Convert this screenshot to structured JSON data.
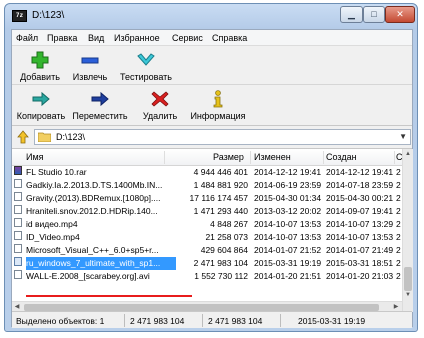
{
  "window": {
    "title": "D:\\123\\",
    "app_icon_text": "7z"
  },
  "menu": [
    "Файл",
    "Правка",
    "Вид",
    "Избранное",
    "Сервис",
    "Справка"
  ],
  "toolbar1": [
    {
      "label": "Добавить",
      "icon": "plus-icon"
    },
    {
      "label": "Извлечь",
      "icon": "minus-icon"
    },
    {
      "label": "Тестировать",
      "icon": "check-icon"
    }
  ],
  "toolbar2": [
    {
      "label": "Копировать",
      "icon": "copy-arrow-icon"
    },
    {
      "label": "Переместить",
      "icon": "move-arrow-icon"
    },
    {
      "label": "Удалить",
      "icon": "delete-x-icon"
    },
    {
      "label": "Информация",
      "icon": "info-icon"
    }
  ],
  "address": {
    "path": "D:\\123\\"
  },
  "columns": {
    "name": "Имя",
    "size": "Размер",
    "modified": "Изменен",
    "created": "Создан",
    "extra": "C"
  },
  "files": [
    {
      "name": "FL Studio 10.rar",
      "size": "4 944 446 401",
      "modified": "2014-12-12 19:41",
      "created": "2014-12-12 19:41",
      "extra": "2",
      "icon": "rar"
    },
    {
      "name": "Gadkiy.Ia.2.2013.D.TS.1400Mb.IN...",
      "size": "1 484 881 920",
      "modified": "2014-06-19 23:59",
      "created": "2014-07-18 23:59",
      "extra": "2",
      "icon": "doc"
    },
    {
      "name": "Gravity.(2013).BDRemux.[1080p]....",
      "size": "17 116 174 457",
      "modified": "2015-04-30 01:34",
      "created": "2015-04-30 00:21",
      "extra": "2",
      "icon": "doc"
    },
    {
      "name": "Hraniteli.snov.2012.D.HDRip.140...",
      "size": "1 471 293 440",
      "modified": "2013-03-12 20:02",
      "created": "2014-09-07 19:41",
      "extra": "2",
      "icon": "doc"
    },
    {
      "name": "id видео.mp4",
      "size": "4 848 267",
      "modified": "2014-10-07 13:53",
      "created": "2014-10-07 13:29",
      "extra": "2",
      "icon": "doc"
    },
    {
      "name": "ID_Video.mp4",
      "size": "21 258 073",
      "modified": "2014-10-07 13:53",
      "created": "2014-10-07 13:53",
      "extra": "2",
      "icon": "doc"
    },
    {
      "name": "Microsoft_Visual_C++_6.0+sp5+r...",
      "size": "429 604 864",
      "modified": "2014-01-07 21:52",
      "created": "2014-01-07 21:49",
      "extra": "2",
      "icon": "doc"
    },
    {
      "name": "ru_windows_7_ultimate_with_sp1...",
      "size": "2 471 983 104",
      "modified": "2015-03-31 19:19",
      "created": "2015-03-31 18:51",
      "extra": "2",
      "icon": "blue",
      "selected": true
    },
    {
      "name": "WALL-E.2008_[scarabey.org].avi",
      "size": "1 552 730 112",
      "modified": "2014-01-20 21:51",
      "created": "2014-01-20 21:03",
      "extra": "2",
      "icon": "doc"
    }
  ],
  "status": {
    "selected": "Выделено объектов: 1",
    "size1": "2 471 983 104",
    "size2": "2 471 983 104",
    "date": "2015-03-31 19:19"
  },
  "colors": {
    "selection": "#3399ff",
    "underline": "#e81c1c"
  }
}
